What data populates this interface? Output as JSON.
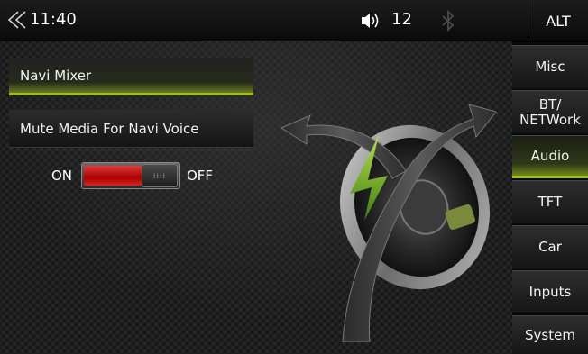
{
  "status_bar": {
    "time": "11:40",
    "volume": "12",
    "alt_label": "ALT",
    "icons": {
      "back": "back-chevron-icon",
      "volume": "speaker-icon",
      "bluetooth": "bluetooth-icon"
    }
  },
  "options": [
    {
      "label": "Navi Mixer",
      "selected": true
    },
    {
      "label": "Mute Media For Navi Voice",
      "selected": false
    }
  ],
  "toggle": {
    "on_label": "ON",
    "off_label": "OFF",
    "state": "on"
  },
  "menu": [
    {
      "label": "Misc",
      "active": false
    },
    {
      "label": "BT/\nNETWork",
      "active": false
    },
    {
      "label": "Audio",
      "active": true
    },
    {
      "label": "TFT",
      "active": false
    },
    {
      "label": "Car",
      "active": false
    },
    {
      "label": "Inputs",
      "active": false
    },
    {
      "label": "System",
      "active": false
    }
  ],
  "colors": {
    "accent": "#9cbf1e",
    "toggle_on": "#cc1f1f"
  }
}
